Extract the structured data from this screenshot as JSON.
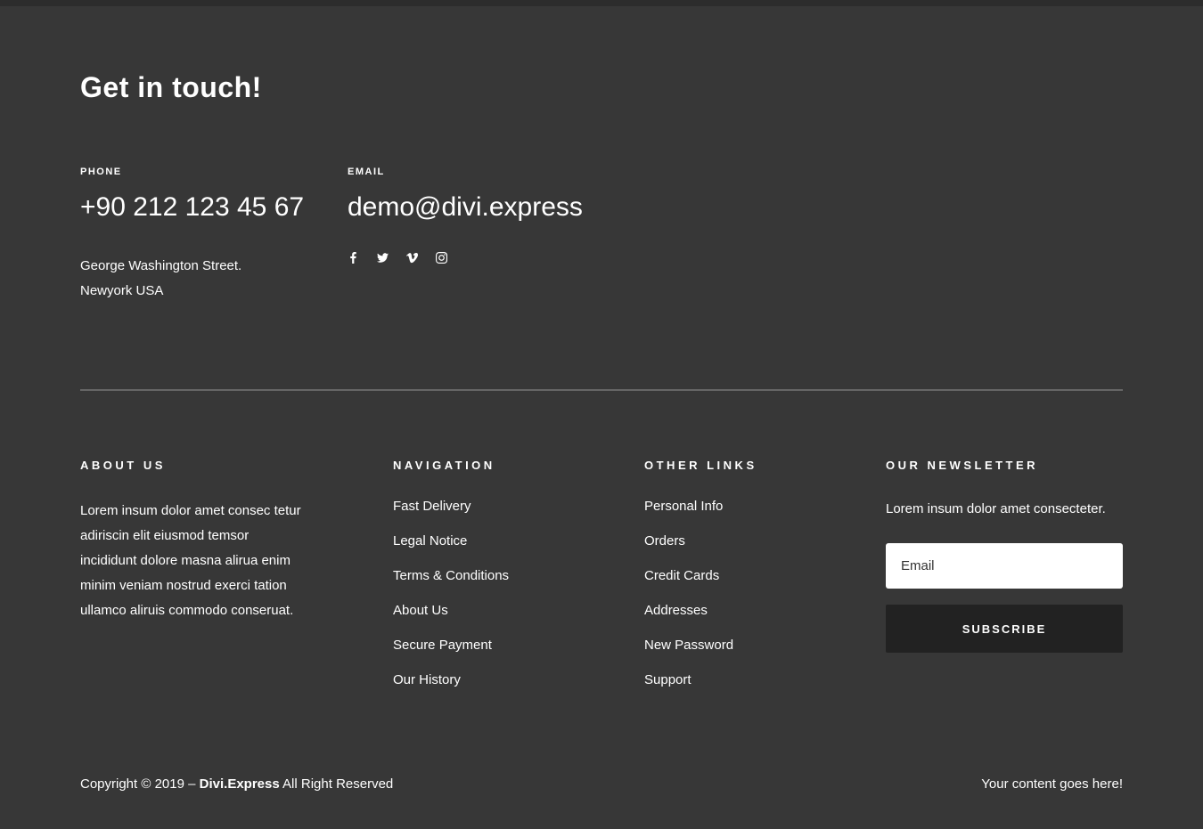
{
  "theme": {
    "background": "#373737",
    "top_strip": "#2c2c2c",
    "text": "#ffffff",
    "button_bg": "#222222",
    "input_bg": "#ffffff",
    "divider": "rgba(255,255,255,0.24)"
  },
  "contact": {
    "heading": "Get in touch!",
    "phone_label": "PHONE",
    "phone_value": "+90 212 123 45 67",
    "email_label": "EMAIL",
    "email_value": "demo@divi.express",
    "address_line1": "George Washington Street.",
    "address_line2": "Newyork USA",
    "social_icons": [
      "facebook",
      "twitter",
      "vimeo",
      "instagram"
    ]
  },
  "widgets": {
    "about": {
      "title": "ABOUT US",
      "text": "Lorem insum dolor amet consec tetur adiriscin elit eiusmod temsor incididunt dolore masna alirua enim minim veniam nostrud exerci tation ullamco aliruis commodo conseruat."
    },
    "navigation": {
      "title": "NAVIGATION",
      "links": [
        "Fast Delivery",
        "Legal Notice",
        "Terms & Conditions",
        "About Us",
        "Secure Payment",
        "Our History"
      ]
    },
    "other_links": {
      "title": "OTHER LINKS",
      "links": [
        "Personal Info",
        "Orders",
        "Credit Cards",
        "Addresses",
        "New Password",
        "Support"
      ]
    },
    "newsletter": {
      "title": "OUR NEWSLETTER",
      "text": "Lorem insum dolor amet consecteter.",
      "email_placeholder": "Email",
      "subscribe_label": "SUBSCRIBE"
    }
  },
  "bottom": {
    "copyright_prefix": "Copyright © 2019 – ",
    "brand": "Divi.Express",
    "copyright_suffix": " All Right Reserved",
    "right_text": "Your content goes here!"
  }
}
